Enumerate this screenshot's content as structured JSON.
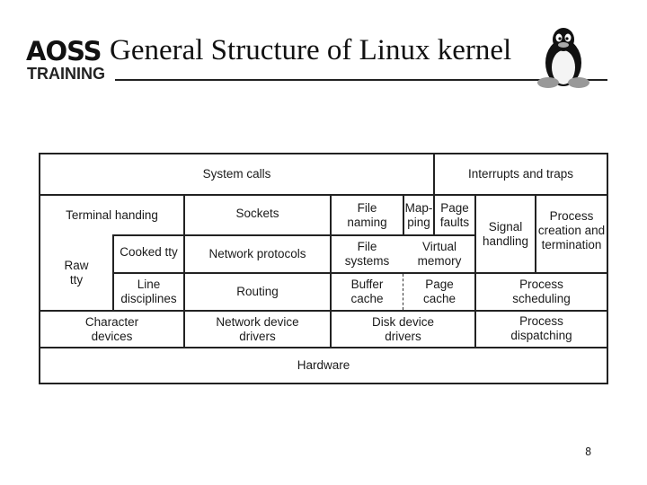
{
  "header": {
    "logo_top": "AOSS",
    "logo_bottom": "TRAINING",
    "title": "General Structure of Linux kernel",
    "mascot_icon": "tux-penguin-icon"
  },
  "diagram": {
    "system_calls": "System calls",
    "interrupts_and_traps": "Interrupts and traps",
    "terminal_handling": "Terminal handing",
    "sockets": "Sockets",
    "file_naming": "File naming",
    "mapping": "Map-ping",
    "mapping_line1": "Map-",
    "mapping_line2": "ping",
    "page_faults": "Page faults",
    "signal_handling": "Signal handling",
    "process_creation": "Process creation and termination",
    "raw_tty": "Raw tty",
    "cooked_tty": "Cooked tty",
    "network_protocols": "Network protocols",
    "file_systems": "File systems",
    "virtual_memory": "Virtual memory",
    "line_disciplines": "Line disciplines",
    "routing": "Routing",
    "buffer_cache": "Buffer cache",
    "page_cache": "Page cache",
    "process_scheduling": "Process scheduling",
    "character_devices": "Character devices",
    "network_device_drivers": "Network device drivers",
    "disk_device_drivers": "Disk device drivers",
    "process_dispatching": "Process dispatching",
    "hardware": "Hardware"
  },
  "footer": {
    "page_number": "8"
  }
}
